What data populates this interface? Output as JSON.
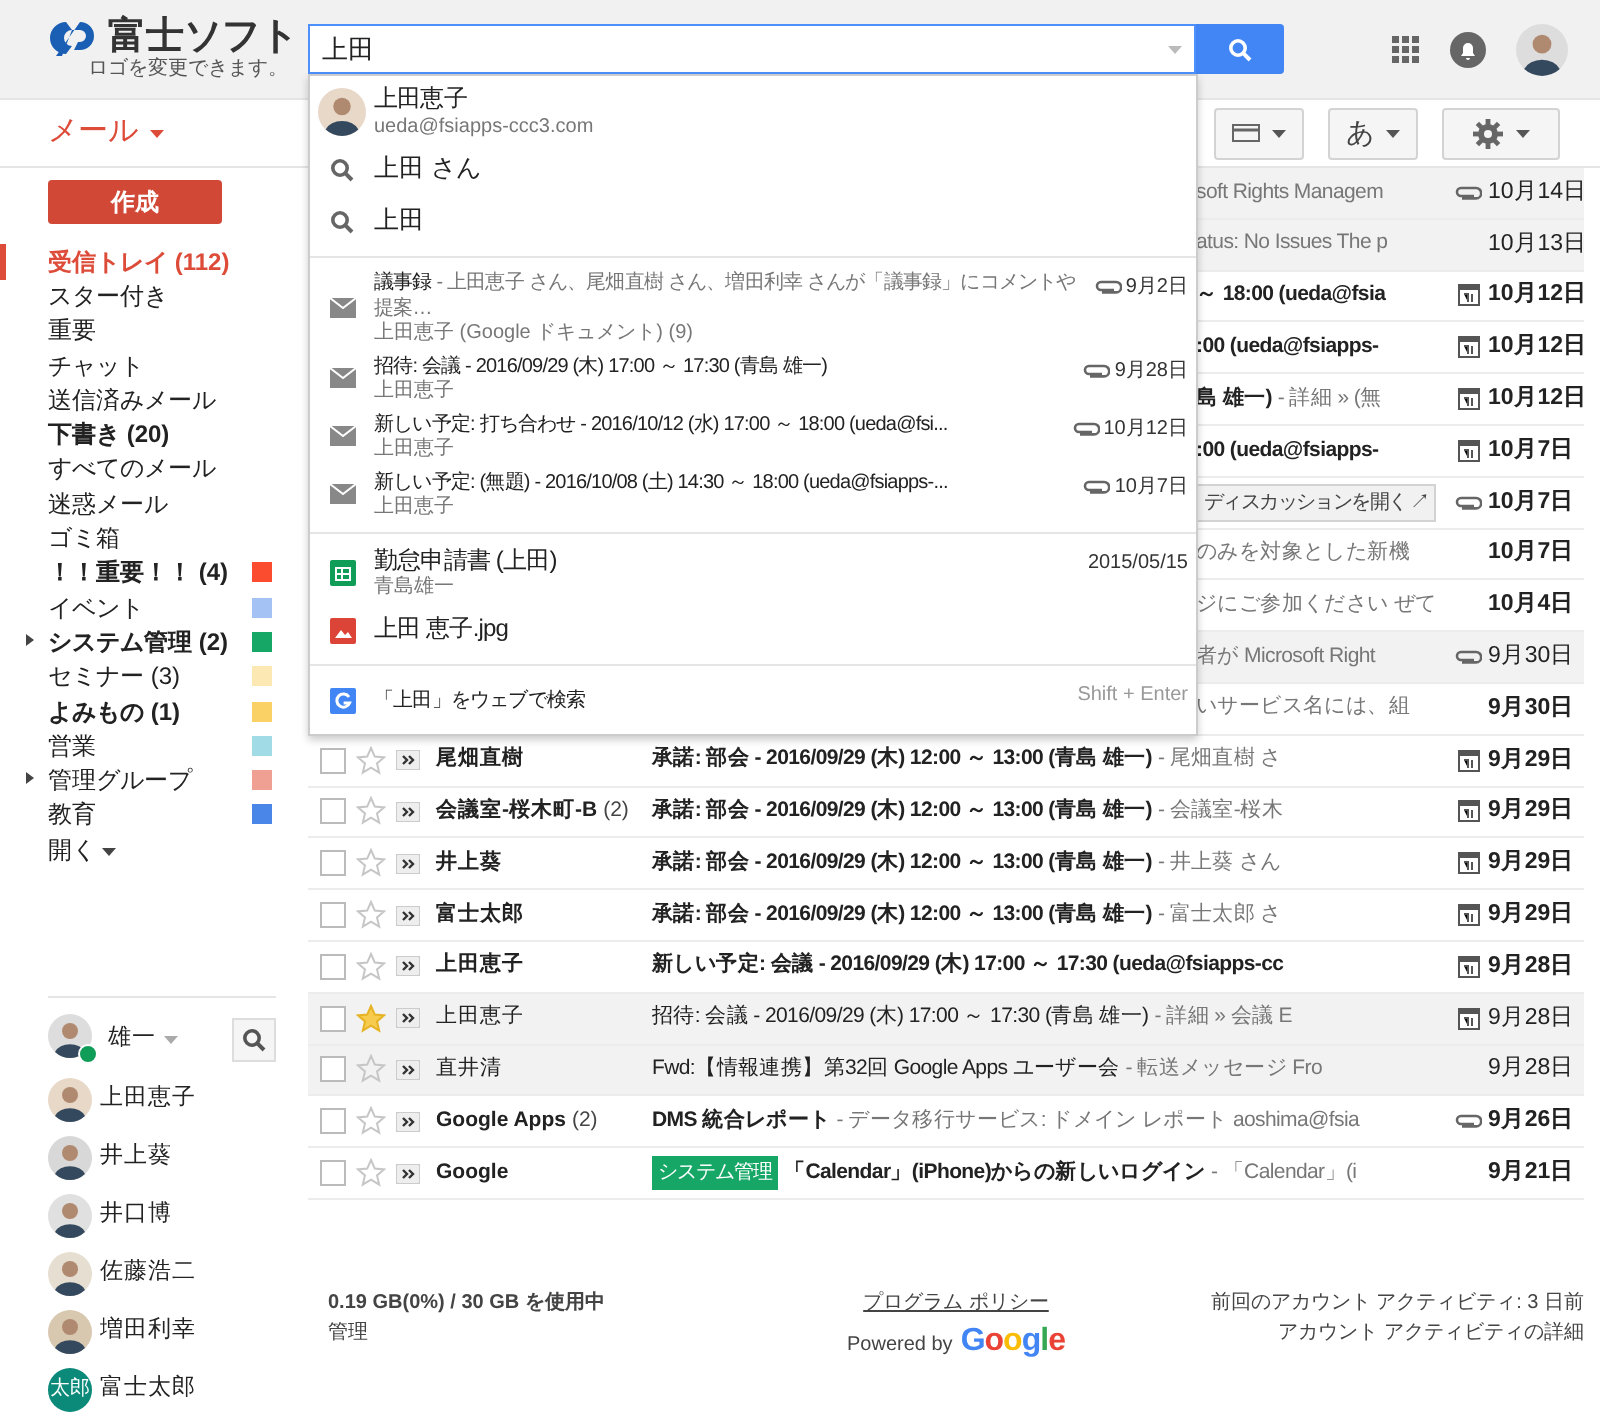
{
  "header": {
    "logo": {
      "name": "富士ソフト",
      "note": "ロゴを変更できます。"
    },
    "search": {
      "value": "上田"
    }
  },
  "suggestions": [
    {
      "kind": "contact",
      "title": "上田恵子",
      "subtitle": "ueda@fsiapps-ccc3.com"
    },
    {
      "kind": "query",
      "title": "上田 さん"
    },
    {
      "kind": "query",
      "title": "上田"
    },
    {
      "kind": "mail",
      "title": "議事録",
      "detail": "- 上田恵子 さん、尾畑直樹 さん、増田利幸 さんが「議事録」にコメントや提案…",
      "subtitle": "上田恵子 (Google ドキュメント) (9)",
      "date": "9月2日"
    },
    {
      "kind": "mail",
      "title": "招待: 会議 - 2016/09/29 (木) 17:00 ～ 17:30 (青島 雄一)",
      "subtitle": "上田恵子",
      "date": "9月28日"
    },
    {
      "kind": "mail",
      "title": "新しい予定: 打ち合わせ - 2016/10/12 (水) 17:00 ～ 18:00 (ueda@fsi...",
      "subtitle": "上田恵子",
      "date": "10月12日"
    },
    {
      "kind": "mail",
      "title": "新しい予定: (無題) - 2016/10/08 (土) 14:30 ～ 18:00 (ueda@fsiapps-...",
      "subtitle": "上田恵子",
      "date": "10月7日"
    },
    {
      "kind": "sheet",
      "title": "勤怠申請書 (上田)",
      "subtitle": "青島雄一",
      "date": "2015/05/15"
    },
    {
      "kind": "image",
      "title": "上田 恵子.jpg"
    },
    {
      "kind": "web",
      "title": "「上田」をウェブで検索",
      "hint": "Shift + Enter"
    }
  ],
  "toolbar": {
    "mail_menu": "メール",
    "input_tool": "あ"
  },
  "sidebar": {
    "compose": "作成",
    "labels": [
      {
        "name": "受信トレイ (112)",
        "bold": true,
        "selected": true
      },
      {
        "name": "スター付き",
        "bold": false,
        "selected": false
      },
      {
        "name": "重要",
        "bold": false,
        "selected": false
      },
      {
        "name": "チャット",
        "bold": false,
        "selected": false
      },
      {
        "name": "送信済みメール",
        "bold": false,
        "selected": false
      },
      {
        "name": "下書き (20)",
        "bold": true,
        "selected": false
      },
      {
        "name": "すべてのメール",
        "bold": false,
        "selected": false
      },
      {
        "name": "迷惑メール",
        "bold": false,
        "selected": false
      },
      {
        "name": "ゴミ箱",
        "bold": false,
        "selected": false
      },
      {
        "name": "！！重要！！ (4)",
        "bold": true,
        "selected": false,
        "color": "#fb4c2f"
      },
      {
        "name": "イベント",
        "bold": false,
        "selected": false,
        "color": "#a4c2f4"
      },
      {
        "name": "システム管理 (2)",
        "bold": true,
        "selected": false,
        "color": "#16a766",
        "expanded": false
      },
      {
        "name": "セミナー (3)",
        "bold": false,
        "selected": false,
        "color": "#fce8b3"
      },
      {
        "name": "よみもの (1)",
        "bold": true,
        "selected": false,
        "color": "#fad165"
      },
      {
        "name": "営業",
        "bold": false,
        "selected": false,
        "color": "#a0dbe6"
      },
      {
        "name": "管理グループ",
        "bold": false,
        "selected": false,
        "color": "#efa093",
        "expanded": false
      },
      {
        "name": "教育",
        "bold": false,
        "selected": false,
        "color": "#4a86e8"
      }
    ],
    "more": "開く"
  },
  "chat": {
    "user": "雄一",
    "contacts": [
      {
        "kind": "photo",
        "name": "上田恵子"
      },
      {
        "kind": "photo",
        "name": "井上葵"
      },
      {
        "kind": "photo",
        "name": "井口博"
      },
      {
        "kind": "photo",
        "name": "佐藤浩二"
      },
      {
        "kind": "photo",
        "name": "増田利幸"
      },
      {
        "kind": "initials",
        "initials": "太郎",
        "color": "#0b8a7a",
        "name": "富士太郎"
      }
    ]
  },
  "rows": [
    {
      "kind": "partial",
      "read": true,
      "snippet": "soft Rights Managem",
      "attachment": true,
      "date": "10月14日"
    },
    {
      "kind": "partial",
      "read": true,
      "snippet": "atus: No Issues The p",
      "date": "10月13日"
    },
    {
      "kind": "partial",
      "read": false,
      "subject": "～ 18:00 (ueda@fsia",
      "calendar": true,
      "date": "10月12日"
    },
    {
      "kind": "partial",
      "read": false,
      "subject": ":00 (ueda@fsiapps-",
      "calendar": true,
      "date": "10月12日"
    },
    {
      "kind": "partial",
      "read": false,
      "subject": "島 雄一)",
      "snippet": "- 詳細 » (無",
      "calendar": true,
      "date": "10月12日"
    },
    {
      "kind": "partial",
      "read": false,
      "subject": ":00 (ueda@fsiapps-",
      "calendar": true,
      "date": "10月7日"
    },
    {
      "kind": "partial",
      "read": false,
      "action": "ディスカッションを開く ↗",
      "attachment": true,
      "date": "10月7日"
    },
    {
      "kind": "partial",
      "read": false,
      "snippet": "のみを対象とした新機",
      "date": "10月7日"
    },
    {
      "kind": "partial",
      "read": false,
      "snippet": "ジにご参加ください ぜて",
      "date": "10月4日"
    },
    {
      "kind": "partial",
      "read": true,
      "snippet": "者が Microsoft Right",
      "attachment": true,
      "date": "9月30日"
    },
    {
      "kind": "partial",
      "read": false,
      "snippet": "いサービス名には、組",
      "date": "9月30日"
    },
    {
      "kind": "full",
      "read": false,
      "starred": false,
      "sender": "尾畑直樹",
      "subject": "承諾: 部会 - 2016/09/29 (木) 12:00 ～ 13:00 (青島 雄一)",
      "snippet": "- 尾畑直樹 さ",
      "calendar": true,
      "date": "9月29日"
    },
    {
      "kind": "full",
      "read": false,
      "starred": false,
      "sender": "会議室-桜木町-B",
      "count": "(2)",
      "subject": "承諾: 部会 - 2016/09/29 (木) 12:00 ～ 13:00 (青島 雄一)",
      "snippet": "- 会議室-桜木",
      "calendar": true,
      "date": "9月29日"
    },
    {
      "kind": "full",
      "read": false,
      "starred": false,
      "sender": "井上葵",
      "subject": "承諾: 部会 - 2016/09/29 (木) 12:00 ～ 13:00 (青島 雄一)",
      "snippet": "- 井上葵 さん",
      "calendar": true,
      "date": "9月29日"
    },
    {
      "kind": "full",
      "read": false,
      "starred": false,
      "sender": "富士太郎",
      "subject": "承諾: 部会 - 2016/09/29 (木) 12:00 ～ 13:00 (青島 雄一)",
      "snippet": "- 富士太郎 さ",
      "calendar": true,
      "date": "9月29日"
    },
    {
      "kind": "full",
      "read": false,
      "starred": false,
      "sender": "上田恵子",
      "subject": "新しい予定: 会議 - 2016/09/29 (木) 17:00 ～ 17:30 (ueda@fsiapps-cc",
      "calendar": true,
      "date": "9月28日"
    },
    {
      "kind": "full",
      "read": true,
      "starred": true,
      "sender": "上田恵子",
      "subject": "招待: 会議 - 2016/09/29 (木) 17:00 ～ 17:30 (青島 雄一)",
      "snippet": "- 詳細 » 会議 E",
      "calendar": true,
      "date": "9月28日"
    },
    {
      "kind": "full",
      "read": true,
      "starred": false,
      "sender": "直井清",
      "subject": "Fwd:【情報連携】第32回 Google Apps ユーザー会",
      "snippet": "- 転送メッセージ Fro",
      "date": "9月28日"
    },
    {
      "kind": "full",
      "read": false,
      "starred": false,
      "sender": "Google Apps",
      "count": "(2)",
      "subject": "DMS 統合レポート",
      "snippet": "- データ移行サービス: ドメイン レポート aoshima@fsia",
      "attachment": true,
      "date": "9月26日"
    },
    {
      "kind": "full",
      "read": false,
      "starred": false,
      "sender": "Google",
      "label": {
        "text": "システム管理",
        "color": "#16a766"
      },
      "subject": "「Calendar」(iPhone)からの新しいログイン",
      "snippet": "- 「Calendar」(i",
      "date": "9月21日"
    }
  ],
  "footer": {
    "storage": "0.19 GB(0%) / 30 GB を使用中",
    "manage": "管理",
    "policy": "プログラム ポリシー",
    "powered_by": "Powered by",
    "google": "Google",
    "last_activity": "前回のアカウント アクティビティ: 3 日前",
    "details": "アカウント アクティビティの詳細"
  }
}
